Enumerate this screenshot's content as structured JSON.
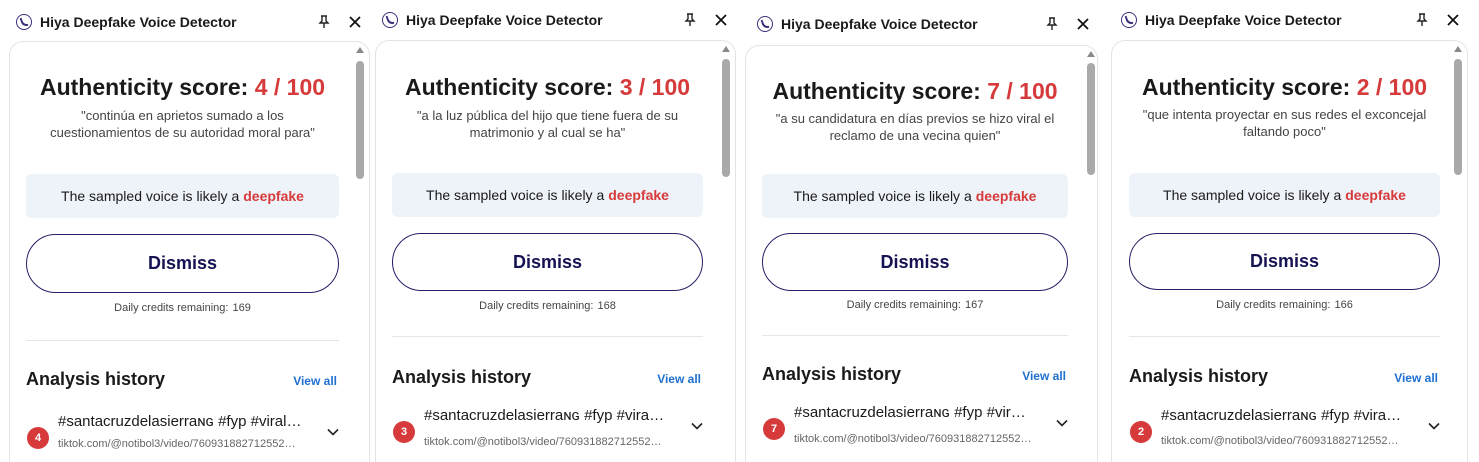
{
  "window_title": "Hiya Deepfake Voice Detector",
  "score_label": "Authenticity score:",
  "verdict_prefix": "The sampled voice is likely a",
  "verdict_word": "deepfake",
  "dismiss_label": "Dismiss",
  "credits_label": "Daily credits remaining:",
  "history_title": "Analysis history",
  "view_all_label": "View all",
  "colors": {
    "accent_red": "#d63a3a",
    "dismiss_navy": "#232067",
    "link_blue": "#1f6fd1",
    "verdict_bg": "#eef2f9"
  },
  "icons": {
    "app": "hiya-logo-icon",
    "pin": "pin-icon",
    "close": "close-icon",
    "expand": "chevron-down-icon"
  },
  "panels": [
    {
      "score": "4 / 100",
      "quote": "\"continúa en aprietos sumado a los cuestionamientos de su autoridad moral para\"",
      "credits": "169",
      "history": [
        {
          "badge": "4",
          "title": "#santacruzdelasierraɴɢ #fyp #viral…",
          "url": "tiktok.com/@notibol3/video/760931882712552…"
        }
      ]
    },
    {
      "score": "3 / 100",
      "quote": "\"a la luz pública del hijo que tiene fuera de su matrimonio y al cual se ha\"",
      "credits": "168",
      "history": [
        {
          "badge": "3",
          "title": "#santacruzdelasierraɴɢ #fyp #viral…",
          "url": "tiktok.com/@notibol3/video/760931882712552…"
        }
      ]
    },
    {
      "score": "7 / 100",
      "quote": "\"a su candidatura en días previos se hizo viral el reclamo de una vecina quien\"",
      "credits": "167",
      "history": [
        {
          "badge": "7",
          "title": "#santacruzdelasierraɴɢ #fyp #viral…",
          "url": "tiktok.com/@notibol3/video/760931882712552…"
        }
      ]
    },
    {
      "score": "2 / 100",
      "quote": "\"que intenta proyectar en sus redes el exconcejal faltando poco\"",
      "credits": "166",
      "history": [
        {
          "badge": "2",
          "title": "#santacruzdelasierraɴɢ #fyp #viral…",
          "url": "tiktok.com/@notibol3/video/760931882712552…"
        }
      ]
    }
  ]
}
